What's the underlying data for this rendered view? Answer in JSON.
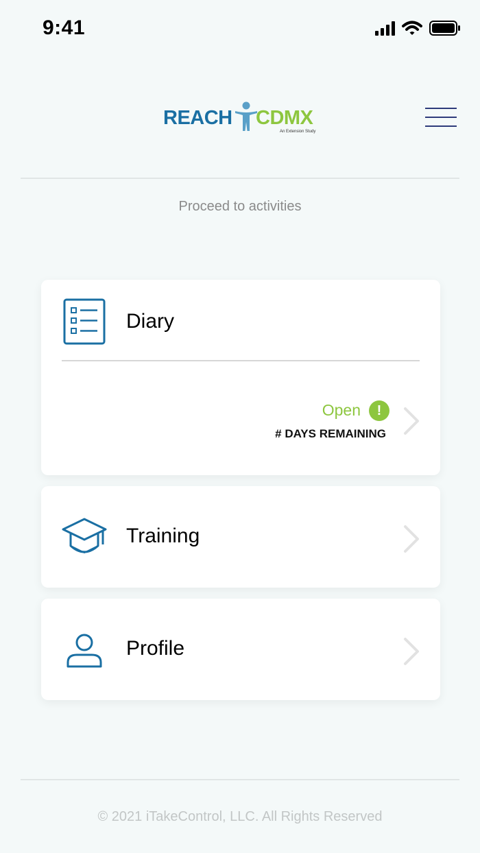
{
  "status_bar": {
    "time": "9:41",
    "icons": [
      "cellular-signal-icon",
      "wifi-icon",
      "battery-icon"
    ]
  },
  "header": {
    "logo_reach": "REACH",
    "logo_cdmx": "CDMX",
    "logo_subtitle": "An Extension Study",
    "menu_icon": "hamburger-menu-icon"
  },
  "subtitle": "Proceed to activities",
  "cards": {
    "diary": {
      "title": "Diary",
      "icon": "checklist-icon",
      "status": "Open",
      "status_icon": "exclamation-icon",
      "status_symbol": "!",
      "days_remaining": "# DAYS REMAINING"
    },
    "training": {
      "title": "Training",
      "icon": "graduation-cap-icon"
    },
    "profile": {
      "title": "Profile",
      "icon": "person-icon"
    }
  },
  "footer": {
    "copyright": "© 2021 iTakeControl, LLC.  All Rights Reserved"
  },
  "colors": {
    "background": "#f4f9f9",
    "brand_blue": "#1a6fa3",
    "brand_green": "#8dc63f",
    "menu_navy": "#2d3a7a"
  }
}
